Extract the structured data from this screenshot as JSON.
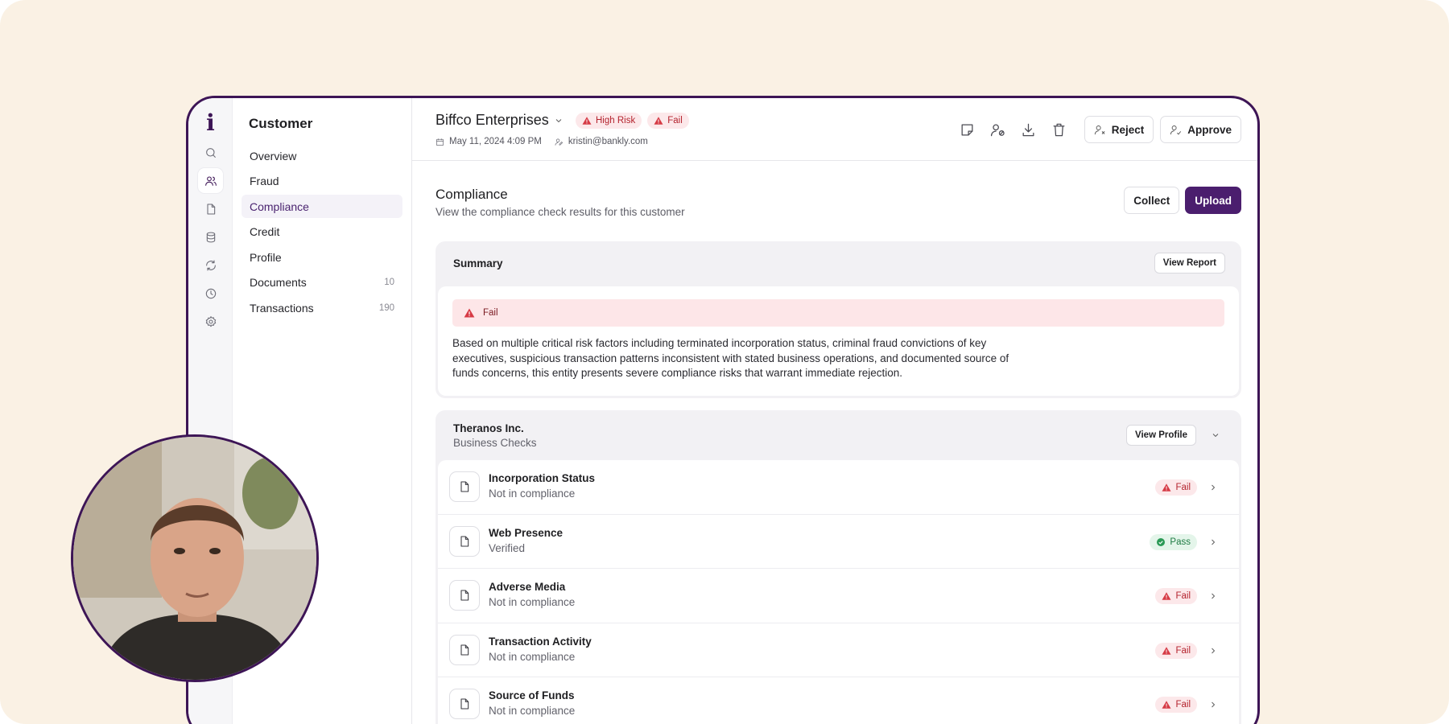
{
  "app": {
    "logo": "i"
  },
  "nav": {
    "title": "Customer",
    "items": [
      {
        "label": "Overview",
        "count": ""
      },
      {
        "label": "Fraud",
        "count": ""
      },
      {
        "label": "Compliance",
        "count": ""
      },
      {
        "label": "Credit",
        "count": ""
      },
      {
        "label": "Profile",
        "count": ""
      },
      {
        "label": "Documents",
        "count": "10"
      },
      {
        "label": "Transactions",
        "count": "190"
      }
    ]
  },
  "header": {
    "entity_name": "Biffco Enterprises",
    "badges": [
      {
        "label": "High Risk"
      },
      {
        "label": "Fail"
      }
    ],
    "date": "May 11, 2024 4:09 PM",
    "email": "kristin@bankly.com",
    "reject_label": "Reject",
    "approve_label": "Approve"
  },
  "section": {
    "title": "Compliance",
    "subtitle": "View the compliance check results for this customer",
    "collect_label": "Collect",
    "upload_label": "Upload"
  },
  "summary": {
    "title": "Summary",
    "view_report_label": "View Report",
    "status": "Fail",
    "text": "Based on multiple critical risk factors including terminated incorporation status, criminal fraud convictions of key executives, suspicious transaction patterns inconsistent with stated business operations, and documented source of funds concerns, this entity presents severe compliance risks that warrant immediate rejection."
  },
  "business": {
    "name": "Theranos Inc.",
    "subtitle": "Business Checks",
    "view_profile_label": "View Profile",
    "checks": [
      {
        "title": "Incorporation Status",
        "subtitle": "Not in compliance",
        "status": "Fail"
      },
      {
        "title": "Web Presence",
        "subtitle": "Verified",
        "status": "Pass"
      },
      {
        "title": "Adverse Media",
        "subtitle": "Not in compliance",
        "status": "Fail"
      },
      {
        "title": "Transaction Activity",
        "subtitle": "Not in compliance",
        "status": "Fail"
      },
      {
        "title": "Source of Funds",
        "subtitle": "Not in compliance",
        "status": "Fail"
      }
    ]
  },
  "colors": {
    "brand": "#4b1e6e",
    "fail": "#b4232e",
    "pass": "#1e7b43",
    "background": "#faf1e4"
  }
}
